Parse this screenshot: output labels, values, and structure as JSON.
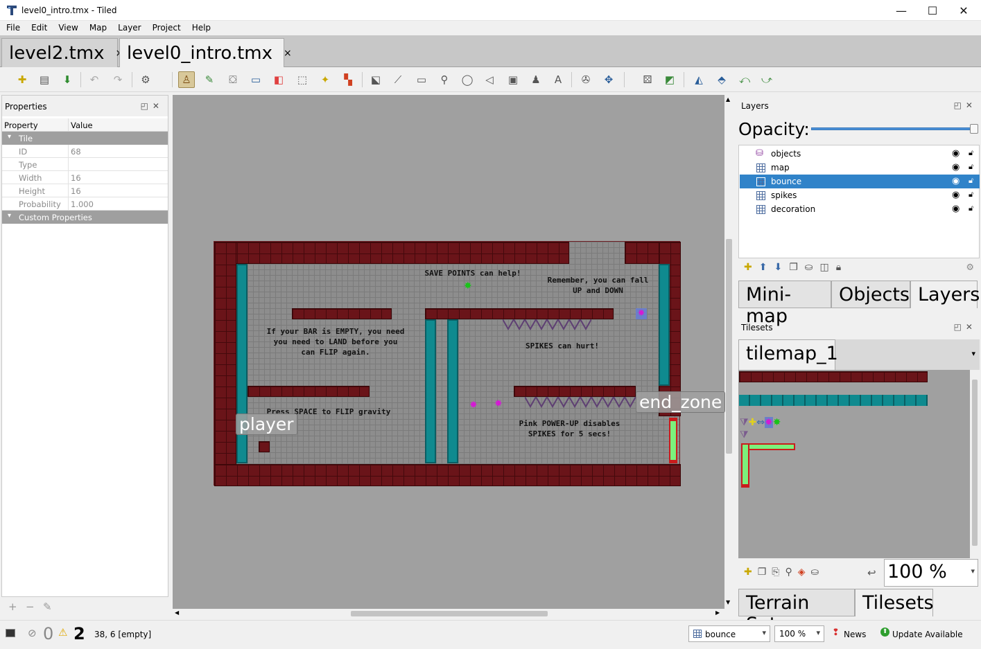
{
  "window": {
    "title": "level0_intro.tmx - Tiled",
    "controls": [
      "—",
      "☐",
      "✕"
    ]
  },
  "menu": [
    "File",
    "Edit",
    "View",
    "Map",
    "Layer",
    "Project",
    "Help"
  ],
  "tabs": [
    {
      "label": "level2.tmx",
      "close": "×",
      "active": false
    },
    {
      "label": "level0_intro.tmx",
      "close": "×",
      "active": true
    }
  ],
  "properties": {
    "title": "Properties",
    "col_property": "Property",
    "col_value": "Value",
    "group_tile": "Tile",
    "rows": [
      {
        "key": "ID",
        "value": "68"
      },
      {
        "key": "Type",
        "value": ""
      },
      {
        "key": "Width",
        "value": "16"
      },
      {
        "key": "Height",
        "value": "16"
      },
      {
        "key": "Probability",
        "value": "1.000"
      }
    ],
    "group_custom": "Custom Properties"
  },
  "map": {
    "texts": [
      "SAVE POINTS can help!",
      "Remember, you can fall\nUP and DOWN",
      "If your BAR is EMPTY, you need\nyou need to LAND before you\ncan FLIP again.",
      "SPIKES can hurt!",
      "Press SPACE to FLIP gravity",
      "Pink POWER-UP disables\nSPIKES for 5 secs!"
    ],
    "objects": [
      "player",
      "end_zone"
    ]
  },
  "layers": {
    "title": "Layers",
    "opacity_label": "Opacity:",
    "opacity": 1.0,
    "items": [
      {
        "name": "objects",
        "type": "object",
        "selected": false
      },
      {
        "name": "map",
        "type": "tile",
        "selected": false
      },
      {
        "name": "bounce",
        "type": "tile",
        "selected": true
      },
      {
        "name": "spikes",
        "type": "tile",
        "selected": false
      },
      {
        "name": "decoration",
        "type": "tile",
        "selected": false
      }
    ],
    "dock_tabs": [
      "Mini-map",
      "Objects",
      "Layers"
    ]
  },
  "tilesets": {
    "title": "Tilesets",
    "tab": "tilemap_1",
    "zoom": "100 %",
    "dock_tabs": [
      "Terrain Sets",
      "Tilesets"
    ]
  },
  "status": {
    "errors": "0",
    "warnings": "2",
    "coords": "38, 6 [empty]",
    "layer_combo": "bounce",
    "zoom_combo": "100 %",
    "news": "News",
    "update": "Update Available"
  },
  "colors": {
    "selection": "#3083c9",
    "brick": "#6a1419",
    "teal": "#0f8a8f"
  }
}
